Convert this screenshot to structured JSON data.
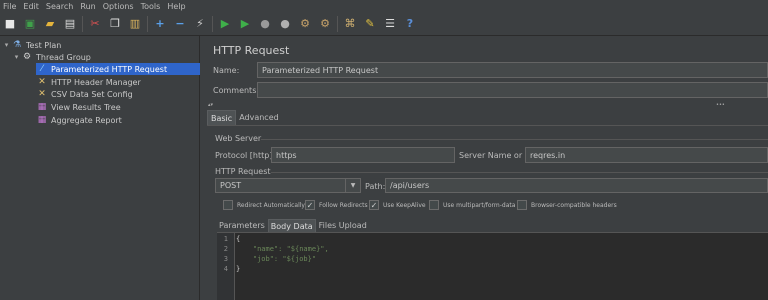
{
  "menu": [
    "File",
    "Edit",
    "Search",
    "Run",
    "Options",
    "Tools",
    "Help"
  ],
  "tree": {
    "items": [
      {
        "label": "Test Plan",
        "icon": "flask-icon"
      },
      {
        "label": "Thread Group",
        "icon": "gear-icon"
      },
      {
        "label": "Parameterized HTTP Request",
        "icon": "pipette-icon"
      },
      {
        "label": "HTTP Header Manager",
        "icon": "wrench-icon"
      },
      {
        "label": "CSV Data Set Config",
        "icon": "wrench-icon"
      },
      {
        "label": "View Results Tree",
        "icon": "chart-icon"
      },
      {
        "label": "Aggregate Report",
        "icon": "chart-icon"
      }
    ]
  },
  "panel": {
    "title": "HTTP Request",
    "name_label": "Name:",
    "name_value": "Parameterized HTTP Request",
    "comments_label": "Comments:",
    "comments_value": "",
    "tabs": [
      "Basic",
      "Advanced"
    ],
    "web_server_label": "Web Server",
    "protocol_label": "Protocol [http]:",
    "protocol_value": "https",
    "server_label": "Server Name or IP:",
    "server_value": "reqres.in",
    "http_request_label": "HTTP Request",
    "method_value": "POST",
    "path_label": "Path:",
    "path_value": "/api/users",
    "checkboxes": [
      {
        "label": "Redirect Automatically",
        "checked": false
      },
      {
        "label": "Follow Redirects",
        "checked": true
      },
      {
        "label": "Use KeepAlive",
        "checked": true
      },
      {
        "label": "Use multipart/form-data",
        "checked": false
      },
      {
        "label": "Browser-compatible headers",
        "checked": false
      }
    ],
    "subtabs": [
      "Parameters",
      "Body Data",
      "Files Upload"
    ],
    "body_lines": [
      "{",
      "    \"name\": \"${name}\",",
      "    \"job\": \"${job}\"",
      "}"
    ],
    "line_numbers": [
      "1",
      "2",
      "3",
      "4"
    ]
  }
}
